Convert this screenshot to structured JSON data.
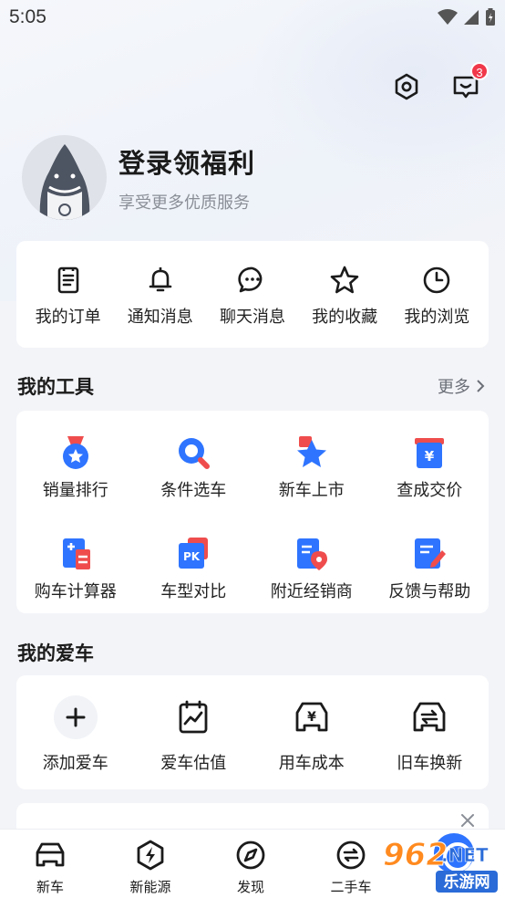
{
  "status_bar": {
    "time": "5:05"
  },
  "header": {
    "message_badge": "3"
  },
  "profile": {
    "title": "登录领福利",
    "subtitle": "享受更多优质服务"
  },
  "quick_actions": [
    {
      "label": "我的订单",
      "icon": "order-icon"
    },
    {
      "label": "通知消息",
      "icon": "bell-icon"
    },
    {
      "label": "聊天消息",
      "icon": "chat-icon"
    },
    {
      "label": "我的收藏",
      "icon": "star-icon"
    },
    {
      "label": "我的浏览",
      "icon": "clock-icon"
    }
  ],
  "tools": {
    "title": "我的工具",
    "more": "更多",
    "items": [
      {
        "label": "销量排行",
        "icon": "medal-icon"
      },
      {
        "label": "条件选车",
        "icon": "search-icon"
      },
      {
        "label": "新车上市",
        "icon": "new-star-icon"
      },
      {
        "label": "查成交价",
        "icon": "price-icon"
      },
      {
        "label": "购车计算器",
        "icon": "calculator-icon"
      },
      {
        "label": "车型对比",
        "icon": "pk-icon"
      },
      {
        "label": "附近经销商",
        "icon": "location-icon"
      },
      {
        "label": "反馈与帮助",
        "icon": "feedback-icon"
      }
    ]
  },
  "my_car": {
    "title": "我的爱车",
    "items": [
      {
        "label": "添加爱车",
        "icon": "plus-icon"
      },
      {
        "label": "爱车估值",
        "icon": "valuation-icon"
      },
      {
        "label": "用车成本",
        "icon": "cost-icon"
      },
      {
        "label": "旧车换新",
        "icon": "trade-in-icon"
      }
    ]
  },
  "tabbar": [
    {
      "label": "新车",
      "icon": "car-icon"
    },
    {
      "label": "新能源",
      "icon": "energy-icon"
    },
    {
      "label": "发现",
      "icon": "compass-icon"
    },
    {
      "label": "二手车",
      "icon": "used-car-icon"
    }
  ],
  "watermark": {
    "text1": "962",
    "text2": ".NET",
    "text3": "乐游网"
  },
  "colors": {
    "accent": "#2e74ff",
    "badge": "#f0384a",
    "red": "#ef4d4d"
  }
}
